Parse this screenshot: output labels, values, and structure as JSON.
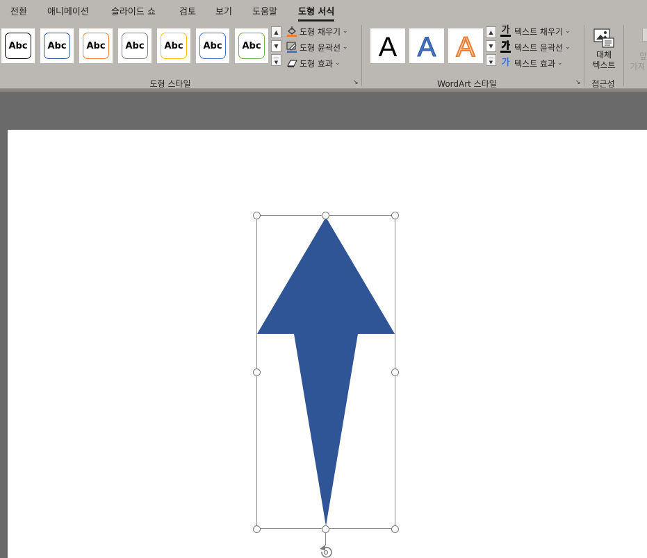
{
  "tabs": [
    {
      "label": "전환"
    },
    {
      "label": "애니메이션"
    },
    {
      "label": "슬라이드 쇼"
    },
    {
      "label": "검토"
    },
    {
      "label": "보기"
    },
    {
      "label": "도움말"
    },
    {
      "label": "도형 서식",
      "active": true
    }
  ],
  "shape_styles": {
    "group_label": "도형 스타일",
    "swatch_text": "Abc",
    "swatch_colors": [
      "#000000",
      "#2e5597",
      "#ed7d31",
      "#7f7f7f",
      "#ffc000",
      "#4472c4",
      "#70ad47"
    ],
    "fill_label": "도형 채우기",
    "outline_label": "도형 윤곽선",
    "effects_label": "도형 효과",
    "fill_bar_color": "#ed7d31",
    "outline_bar_color": "#4472c4"
  },
  "wordart_styles": {
    "group_label": "WordArt 스타일",
    "letter": "A",
    "styles": [
      "black",
      "blue-outline",
      "orange-outline"
    ],
    "text_fill_label": "텍스트 채우기",
    "text_outline_label": "텍스트 윤곽선",
    "text_effects_label": "텍스트 효과",
    "ga_glyph": "가"
  },
  "accessibility": {
    "group_label": "접근성",
    "alt_text_line1": "대체",
    "alt_text_line2": "텍스트"
  },
  "partial_next_group": {
    "line1": "앞",
    "line2": "가져"
  },
  "shape": {
    "type": "arrow-up",
    "fill_color": "#2f5597"
  },
  "icons": [
    "paint-bucket-icon",
    "pen-outline-icon",
    "shape-effects-icon",
    "text-fill-icon",
    "text-outline-icon",
    "text-effects-icon",
    "alt-text-icon",
    "rotate-handle-icon",
    "dialog-launcher-icon",
    "chevron-down-icon"
  ]
}
